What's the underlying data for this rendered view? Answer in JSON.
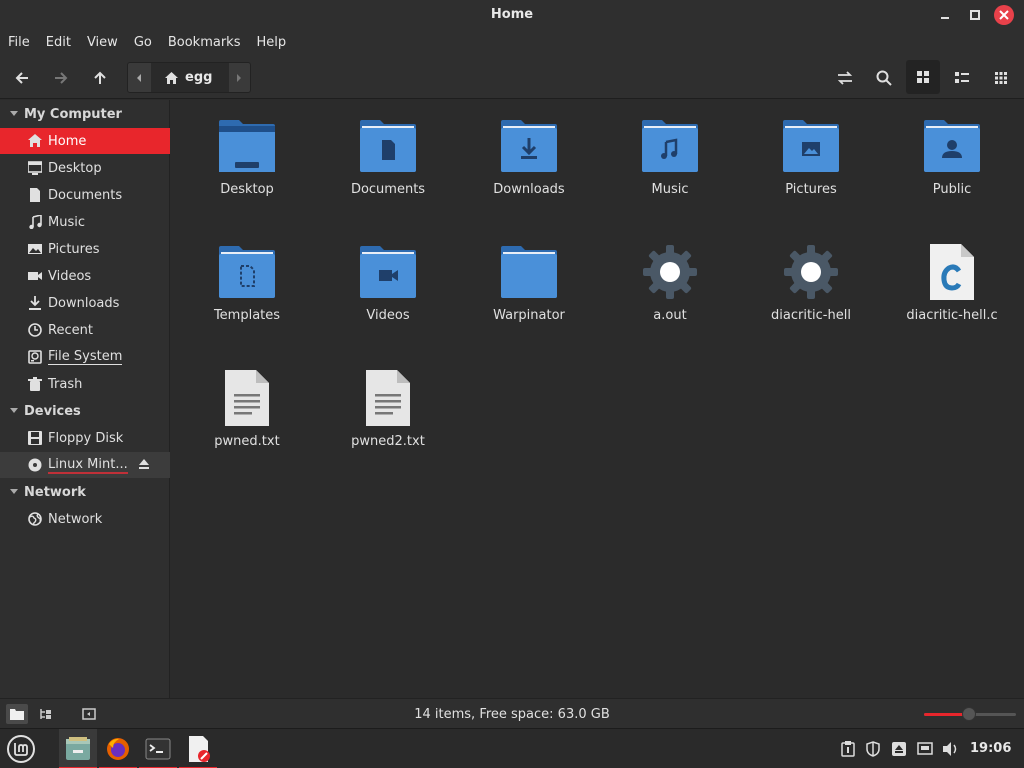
{
  "window": {
    "title": "Home"
  },
  "menu": [
    "File",
    "Edit",
    "View",
    "Go",
    "Bookmarks",
    "Help"
  ],
  "pathbar": {
    "crumb": "egg"
  },
  "sidebar": {
    "sections": [
      {
        "label": "My Computer",
        "items": [
          {
            "label": "Home",
            "icon": "home-icon",
            "selected": true
          },
          {
            "label": "Desktop",
            "icon": "desktop-icon"
          },
          {
            "label": "Documents",
            "icon": "document-icon"
          },
          {
            "label": "Music",
            "icon": "music-icon"
          },
          {
            "label": "Pictures",
            "icon": "picture-icon"
          },
          {
            "label": "Videos",
            "icon": "video-icon"
          },
          {
            "label": "Downloads",
            "icon": "download-icon"
          },
          {
            "label": "Recent",
            "icon": "clock-icon"
          },
          {
            "label": "File System",
            "icon": "drive-icon"
          },
          {
            "label": "Trash",
            "icon": "trash-icon"
          }
        ]
      },
      {
        "label": "Devices",
        "items": [
          {
            "label": "Floppy Disk",
            "icon": "floppy-icon"
          },
          {
            "label": "Linux Mint...",
            "icon": "disc-icon"
          }
        ]
      },
      {
        "label": "Network",
        "items": [
          {
            "label": "Network",
            "icon": "globe-icon"
          }
        ]
      }
    ]
  },
  "files": [
    {
      "name": "Desktop",
      "type": "folder-desktop"
    },
    {
      "name": "Documents",
      "type": "folder-documents"
    },
    {
      "name": "Downloads",
      "type": "folder-downloads"
    },
    {
      "name": "Music",
      "type": "folder-music"
    },
    {
      "name": "Pictures",
      "type": "folder-pictures"
    },
    {
      "name": "Public",
      "type": "folder-public"
    },
    {
      "name": "Templates",
      "type": "folder-templates"
    },
    {
      "name": "Videos",
      "type": "folder-videos"
    },
    {
      "name": "Warpinator",
      "type": "folder"
    },
    {
      "name": "a.out",
      "type": "executable"
    },
    {
      "name": "diacritic-hell",
      "type": "executable"
    },
    {
      "name": "diacritic-hell.c",
      "type": "c-source"
    },
    {
      "name": "pwned.txt",
      "type": "text"
    },
    {
      "name": "pwned2.txt",
      "type": "text"
    }
  ],
  "status": {
    "text": "14 items, Free space: 63.0 GB",
    "zoom_fraction": 0.49
  },
  "taskbar": {
    "clock": "19:06"
  },
  "colors": {
    "accent": "#e8262c",
    "folder": "#4a90d9",
    "folder_dark": "#2e6bb0"
  }
}
